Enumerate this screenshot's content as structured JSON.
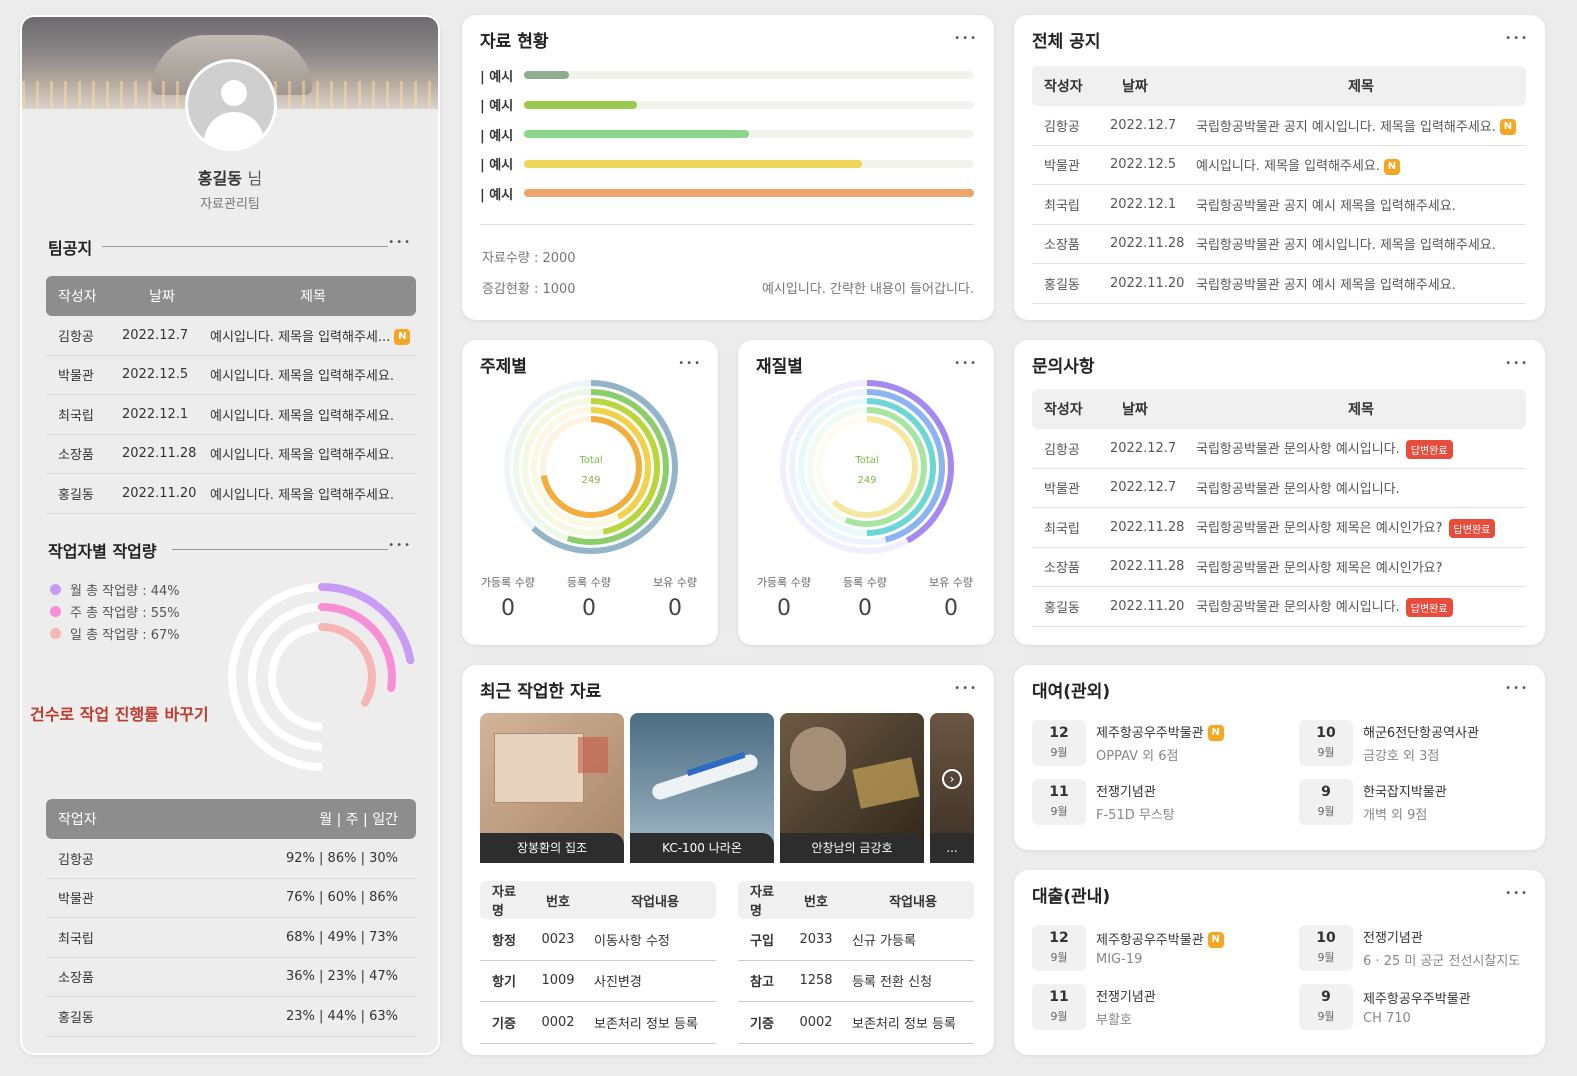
{
  "profile": {
    "name": "홍길동",
    "suffix": "님",
    "team": "자료관리팀"
  },
  "team_notice": {
    "title": "팀공지",
    "headers": [
      "작성자",
      "날짜",
      "제목"
    ],
    "rows": [
      {
        "author": "김항공",
        "date": "2022.12.7",
        "title": "예시입니다. 제목을 입력해주세...",
        "badge": "N"
      },
      {
        "author": "박물관",
        "date": "2022.12.5",
        "title": "예시입니다. 제목을 입력해주세요."
      },
      {
        "author": "최국립",
        "date": "2022.12.1",
        "title": "예시입니다. 제목을 입력해주세요."
      },
      {
        "author": "소장품",
        "date": "2022.11.28",
        "title": "예시입니다. 제목을 입력해주세요."
      },
      {
        "author": "홍길동",
        "date": "2022.11.20",
        "title": "예시입니다. 제목을 입력해주세요."
      }
    ]
  },
  "workload": {
    "title": "작업자별 작업량",
    "legend": [
      {
        "label": "월 총 작업량 : 44%",
        "color": "#c89cf5",
        "value": 0.44
      },
      {
        "label": "주 총 작업량 : 55%",
        "color": "#f78fd6",
        "value": 0.55
      },
      {
        "label": "일 총 작업량 : 67%",
        "color": "#f7b6b6",
        "value": 0.67
      }
    ],
    "note": "건수로 작업 진행률 바꾸기",
    "table_headers": [
      "작업자",
      "월 | 주 | 일간"
    ],
    "rows": [
      {
        "name": "김항공",
        "vals": "92% | 86% | 30%"
      },
      {
        "name": "박물관",
        "vals": "76% | 60% | 86%"
      },
      {
        "name": "최국립",
        "vals": "68% | 49% | 73%"
      },
      {
        "name": "소장품",
        "vals": "36% | 23% | 47%"
      },
      {
        "name": "홍길동",
        "vals": "23% | 44% | 63%"
      }
    ]
  },
  "status": {
    "title": "자료 현황",
    "bars": [
      {
        "label": "| 예시",
        "value": 0.1,
        "color": "#8fae8f"
      },
      {
        "label": "| 예시",
        "value": 0.25,
        "color": "#9bc94b"
      },
      {
        "label": "| 예시",
        "value": 0.5,
        "color": "#8dd68d"
      },
      {
        "label": "| 예시",
        "value": 0.75,
        "color": "#efd65a"
      },
      {
        "label": "| 예시",
        "value": 1.0,
        "color": "#eea46a"
      }
    ],
    "count": "자료수량 : 2000",
    "change": "증감현황 : 1000",
    "desc": "예시입니다. 간략한 내용이 들어갑니다."
  },
  "all_notice": {
    "title": "전체 공지",
    "headers": [
      "작성자",
      "날짜",
      "제목"
    ],
    "rows": [
      {
        "author": "김항공",
        "date": "2022.12.7",
        "title": "국립항공박물관 공지 예시입니다. 제목을 입력해주세요.",
        "badge": "N"
      },
      {
        "author": "박물관",
        "date": "2022.12.5",
        "title": "예시입니다. 제목을 입력해주세요.",
        "badge": "N"
      },
      {
        "author": "최국립",
        "date": "2022.12.1",
        "title": "국립항공박물관 공지 예시 제목을 입력해주세요."
      },
      {
        "author": "소장품",
        "date": "2022.11.28",
        "title": "국립항공박물관 공지 예시입니다. 제목을 입력해주세요."
      },
      {
        "author": "홍길동",
        "date": "2022.11.20",
        "title": "국립항공박물관 공지 예시 제목을 입력해주세요."
      }
    ]
  },
  "subject": {
    "title": "주제별",
    "total_label": "Total",
    "total": "249",
    "stats": [
      {
        "label": "가등록 수량",
        "value": "0"
      },
      {
        "label": "등록 수량",
        "value": "0"
      },
      {
        "label": "보유 수량",
        "value": "0"
      }
    ],
    "rings": [
      {
        "value": 0.62,
        "color": "#94b4c8"
      },
      {
        "value": 0.55,
        "color": "#8ccf6a"
      },
      {
        "value": 0.47,
        "color": "#b9d63b"
      },
      {
        "value": 0.42,
        "color": "#f1d24a"
      },
      {
        "value": 0.72,
        "color": "#f2ad3b"
      }
    ]
  },
  "material": {
    "title": "재질별",
    "total_label": "Total",
    "total": "249",
    "stats": [
      {
        "label": "가등록 수량",
        "value": "0"
      },
      {
        "label": "등록 수량",
        "value": "0"
      },
      {
        "label": "보유 수량",
        "value": "0"
      }
    ],
    "rings": [
      {
        "value": 0.42,
        "color": "#a48af0"
      },
      {
        "value": 0.46,
        "color": "#8cb3f2"
      },
      {
        "value": 0.5,
        "color": "#6ed6d6"
      },
      {
        "value": 0.56,
        "color": "#a7e6a1"
      },
      {
        "value": 0.62,
        "color": "#f5e6a0"
      }
    ]
  },
  "inquiry": {
    "title": "문의사항",
    "headers": [
      "작성자",
      "날짜",
      "제목"
    ],
    "rows": [
      {
        "author": "김항공",
        "date": "2022.12.7",
        "title": "국립항공박물관 문의사항  예시입니다.",
        "badge": "답변완료"
      },
      {
        "author": "박물관",
        "date": "2022.12.7",
        "title": "국립항공박물관 문의사항  예시입니다."
      },
      {
        "author": "최국립",
        "date": "2022.11.28",
        "title": "국립항공박물관 문의사항  제목은 예시인가요?",
        "badge": "답변완료"
      },
      {
        "author": "소장품",
        "date": "2022.11.28",
        "title": "국립항공박물관 문의사항  제목은 예시인가요?"
      },
      {
        "author": "홍길동",
        "date": "2022.11.20",
        "title": "국립항공박물관 문의사항  예시입니다.",
        "badge": "답변완료"
      }
    ]
  },
  "recent": {
    "title": "최근 작업한 자료",
    "thumbs": [
      "장봉환의 집조",
      "KC-100 나라온",
      "안창남의 금강호",
      "..."
    ],
    "headers": [
      "자료명",
      "번호",
      "작업내용"
    ],
    "left_rows": [
      {
        "name": "항정",
        "no": "0023",
        "work": "이동사항 수정"
      },
      {
        "name": "항기",
        "no": "1009",
        "work": "사진변경"
      },
      {
        "name": "기증",
        "no": "0002",
        "work": "보존처리 정보 등록"
      }
    ],
    "right_rows": [
      {
        "name": "구입",
        "no": "2033",
        "work": "신규 가등록"
      },
      {
        "name": "참고",
        "no": "1258",
        "work": "등록 전환 신청"
      },
      {
        "name": "기증",
        "no": "0002",
        "work": "보존처리 정보 등록"
      }
    ]
  },
  "loan_out": {
    "title": "대여(관외)",
    "items": [
      {
        "day": "12",
        "month": "9월",
        "place": "제주항공우주박물관",
        "item": "OPPAV 외 6점",
        "badge": "N"
      },
      {
        "day": "10",
        "month": "9월",
        "place": "해군6전단항공역사관",
        "item": "금강호 외 3점"
      },
      {
        "day": "11",
        "month": "9월",
        "place": "전쟁기념관",
        "item": "F-51D 무스탕"
      },
      {
        "day": "9",
        "month": "9월",
        "place": "한국잡지박물관",
        "item": "개벽 외 9점"
      }
    ]
  },
  "loan_in": {
    "title": "대출(관내)",
    "items": [
      {
        "day": "12",
        "month": "9월",
        "place": "제주항공우주박물관",
        "item": "MIG-19",
        "badge": "N"
      },
      {
        "day": "10",
        "month": "9월",
        "place": "전쟁기념관",
        "item": "6 · 25 미 공군 전선시찰지도"
      },
      {
        "day": "11",
        "month": "9월",
        "place": "전쟁기념관",
        "item": "부활호"
      },
      {
        "day": "9",
        "month": "9월",
        "place": "제주항공우주박물관",
        "item": "CH 710"
      }
    ]
  }
}
